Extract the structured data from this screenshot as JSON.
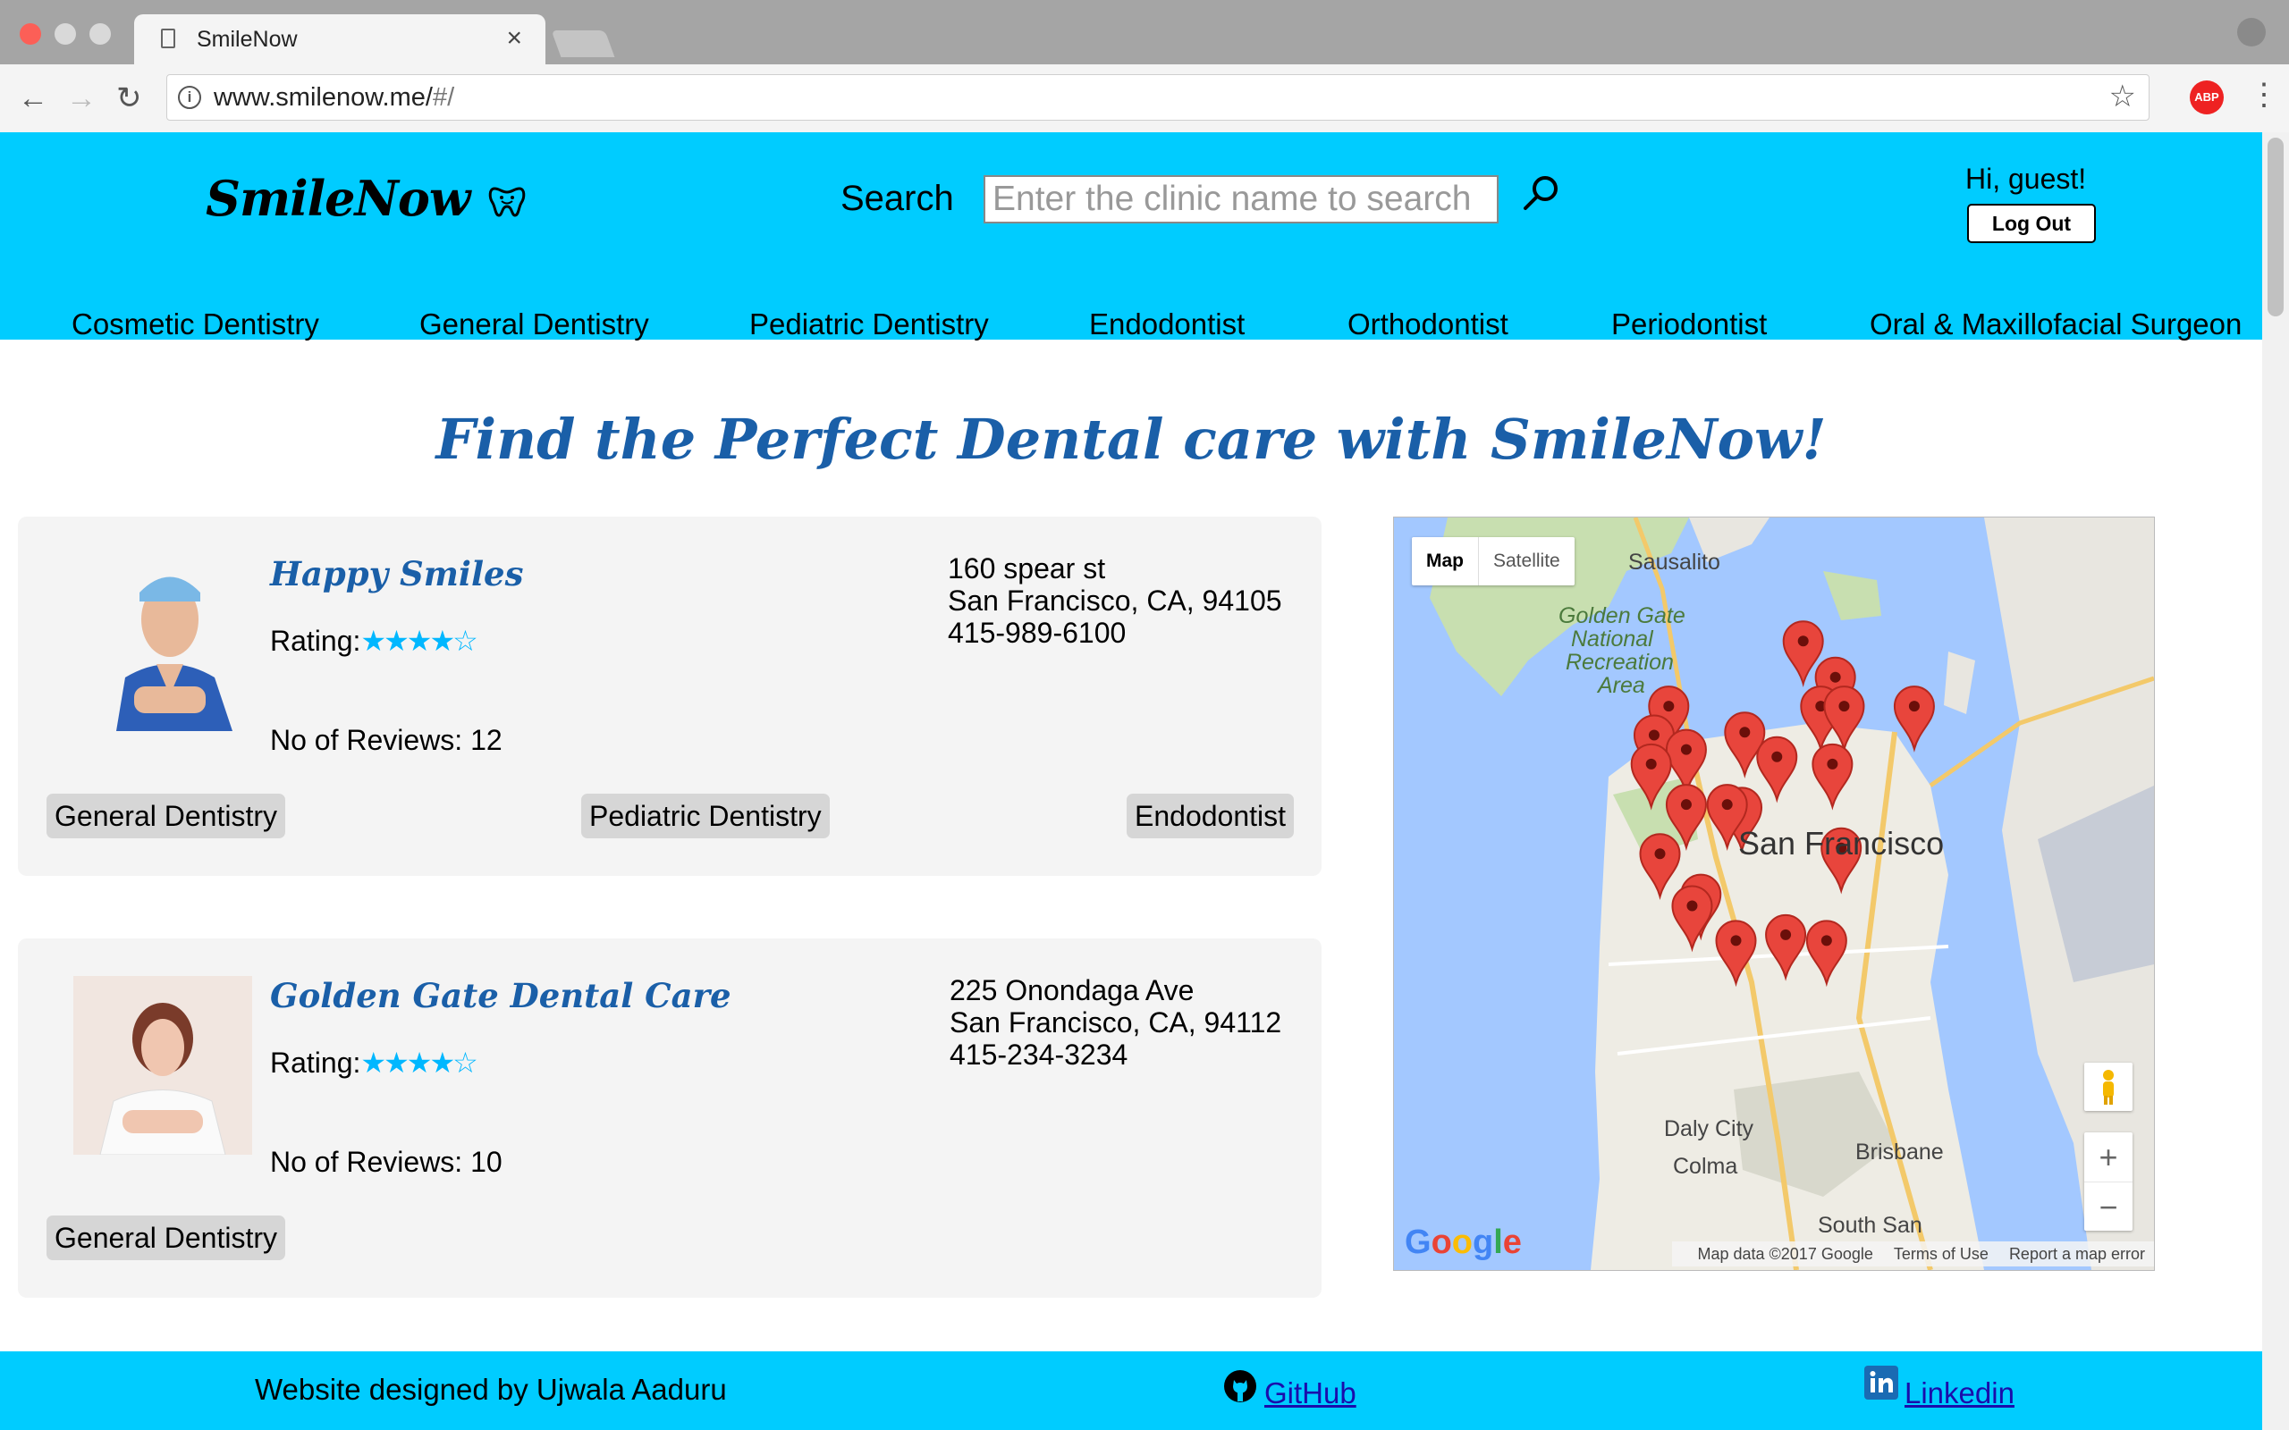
{
  "browser": {
    "tab_title": "SmileNow",
    "close_glyph": "×",
    "url_main": "www.smilenow.me/",
    "url_dim": "#/",
    "back_icon": "←",
    "forward_icon": "→",
    "reload_icon": "↻",
    "bookmark_icon": "☆",
    "abp_label": "ABP",
    "menu_icon": "⋮"
  },
  "header": {
    "logo": "SmileNow",
    "search_label": "Search",
    "search_placeholder": "Enter the clinic name to search",
    "greeting": "Hi, guest!",
    "logout_label": "Log Out",
    "categories": [
      "Cosmetic Dentistry",
      "General Dentistry",
      "Pediatric Dentistry",
      "Endodontist",
      "Orthodontist",
      "Periodontist",
      "Oral & Maxillofacial Surgeon"
    ]
  },
  "headline": "Find the Perfect Dental care with SmileNow!",
  "clinics": [
    {
      "name": "Happy Smiles",
      "rating_label": "Rating:",
      "rating": 4,
      "rating_max": 5,
      "stars": "★★★★☆",
      "reviews": "No of Reviews: 12",
      "address_line1": "160 spear st",
      "address_line2": "San Francisco, CA, 94105",
      "phone": "415-989-6100",
      "tags": [
        "General Dentistry",
        "Pediatric Dentistry",
        "Endodontist"
      ]
    },
    {
      "name": "Golden Gate Dental Care",
      "rating_label": "Rating:",
      "rating": 4,
      "rating_max": 5,
      "stars": "★★★★☆",
      "reviews": "No of Reviews: 10",
      "address_line1": "225 Onondaga Ave",
      "address_line2": "San Francisco, CA, 94112",
      "phone": "415-234-3234",
      "tags": [
        "General Dentistry"
      ]
    }
  ],
  "map": {
    "map_label": "Map",
    "satellite_label": "Satellite",
    "city": "San Francisco",
    "labels": [
      "Sausalito",
      "Golden Gate",
      "National",
      "Recreation",
      "Area",
      "Daly City",
      "Colma",
      "Brisbane",
      "South San"
    ],
    "google": "Google",
    "credits": [
      "Map data ©2017 Google",
      "Terms of Use",
      "Report a map error"
    ],
    "zoom_in": "+",
    "zoom_out": "−",
    "marker_count": 22
  },
  "footer": {
    "credit": "Website designed by Ujwala Aaduru",
    "github": "GitHub",
    "linkedin": "Linkedin"
  },
  "colors": {
    "brand": "#00ccff",
    "headline": "#1a5fa8",
    "stars": "#00b7ff",
    "marker": "#e8453c"
  }
}
